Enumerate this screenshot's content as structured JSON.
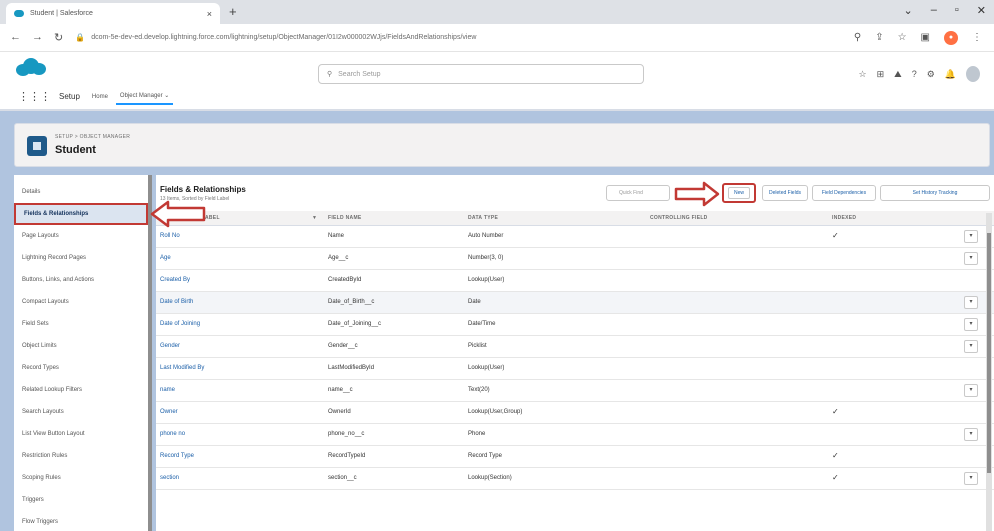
{
  "browser": {
    "tab_title": "Student | Salesforce",
    "tab_close": "×",
    "new_tab": "+",
    "url": "dcom-5e-dev-ed.develop.lightning.force.com/lightning/setup/ObjectManager/01I2w000002WJjs/FieldsAndRelationships/view"
  },
  "sf_header": {
    "search_placeholder": "Search Setup"
  },
  "setup_nav": {
    "app_name": "Setup",
    "home": "Home",
    "object_manager": "Object Manager"
  },
  "object": {
    "breadcrumb": "SETUP > OBJECT MANAGER",
    "name": "Student"
  },
  "sidebar": {
    "items": [
      {
        "label": "Details"
      },
      {
        "label": "Fields & Relationships"
      },
      {
        "label": "Page Layouts"
      },
      {
        "label": "Lightning Record Pages"
      },
      {
        "label": "Buttons, Links, and Actions"
      },
      {
        "label": "Compact Layouts"
      },
      {
        "label": "Field Sets"
      },
      {
        "label": "Object Limits"
      },
      {
        "label": "Record Types"
      },
      {
        "label": "Related Lookup Filters"
      },
      {
        "label": "Search Layouts"
      },
      {
        "label": "List View Button Layout"
      },
      {
        "label": "Restriction Rules"
      },
      {
        "label": "Scoping Rules"
      },
      {
        "label": "Triggers"
      },
      {
        "label": "Flow Triggers"
      }
    ]
  },
  "main": {
    "title": "Fields & Relationships",
    "subtitle": "13 Items, Sorted by Field Label",
    "quick_find_placeholder": "Quick Find",
    "new_button": "New",
    "deleted_fields": "Deleted Fields",
    "field_dependencies": "Field Dependencies",
    "set_history_tracking": "Set History Tracking",
    "columns": [
      "FIELD LABEL",
      "FIELD NAME",
      "DATA TYPE",
      "CONTROLLING FIELD",
      "INDEXED"
    ],
    "rows": [
      {
        "label": "Roll No",
        "api": "Name",
        "type": "Auto Number",
        "indexed": "✓"
      },
      {
        "label": "Age",
        "api": "Age__c",
        "type": "Number(3, 0)",
        "indexed": ""
      },
      {
        "label": "Created By",
        "api": "CreatedById",
        "type": "Lookup(User)",
        "indexed": ""
      },
      {
        "label": "Date of Birth",
        "api": "Date_of_Birth__c",
        "type": "Date",
        "indexed": ""
      },
      {
        "label": "Date of Joining",
        "api": "Date_of_Joining__c",
        "type": "Date/Time",
        "indexed": ""
      },
      {
        "label": "Gender",
        "api": "Gender__c",
        "type": "Picklist",
        "indexed": ""
      },
      {
        "label": "Last Modified By",
        "api": "LastModifiedById",
        "type": "Lookup(User)",
        "indexed": ""
      },
      {
        "label": "name",
        "api": "name__c",
        "type": "Text(20)",
        "indexed": ""
      },
      {
        "label": "Owner",
        "api": "OwnerId",
        "type": "Lookup(User,Group)",
        "indexed": "✓"
      },
      {
        "label": "phone no",
        "api": "phone_no__c",
        "type": "Phone",
        "indexed": ""
      },
      {
        "label": "Record Type",
        "api": "RecordTypeId",
        "type": "Record Type",
        "indexed": "✓"
      },
      {
        "label": "section",
        "api": "section__c",
        "type": "Lookup(Section)",
        "indexed": "✓"
      }
    ]
  },
  "colors": {
    "annotation_red": "#c23934",
    "salesforce_blue": "#1798c1",
    "link_blue": "#1b5fa8"
  }
}
